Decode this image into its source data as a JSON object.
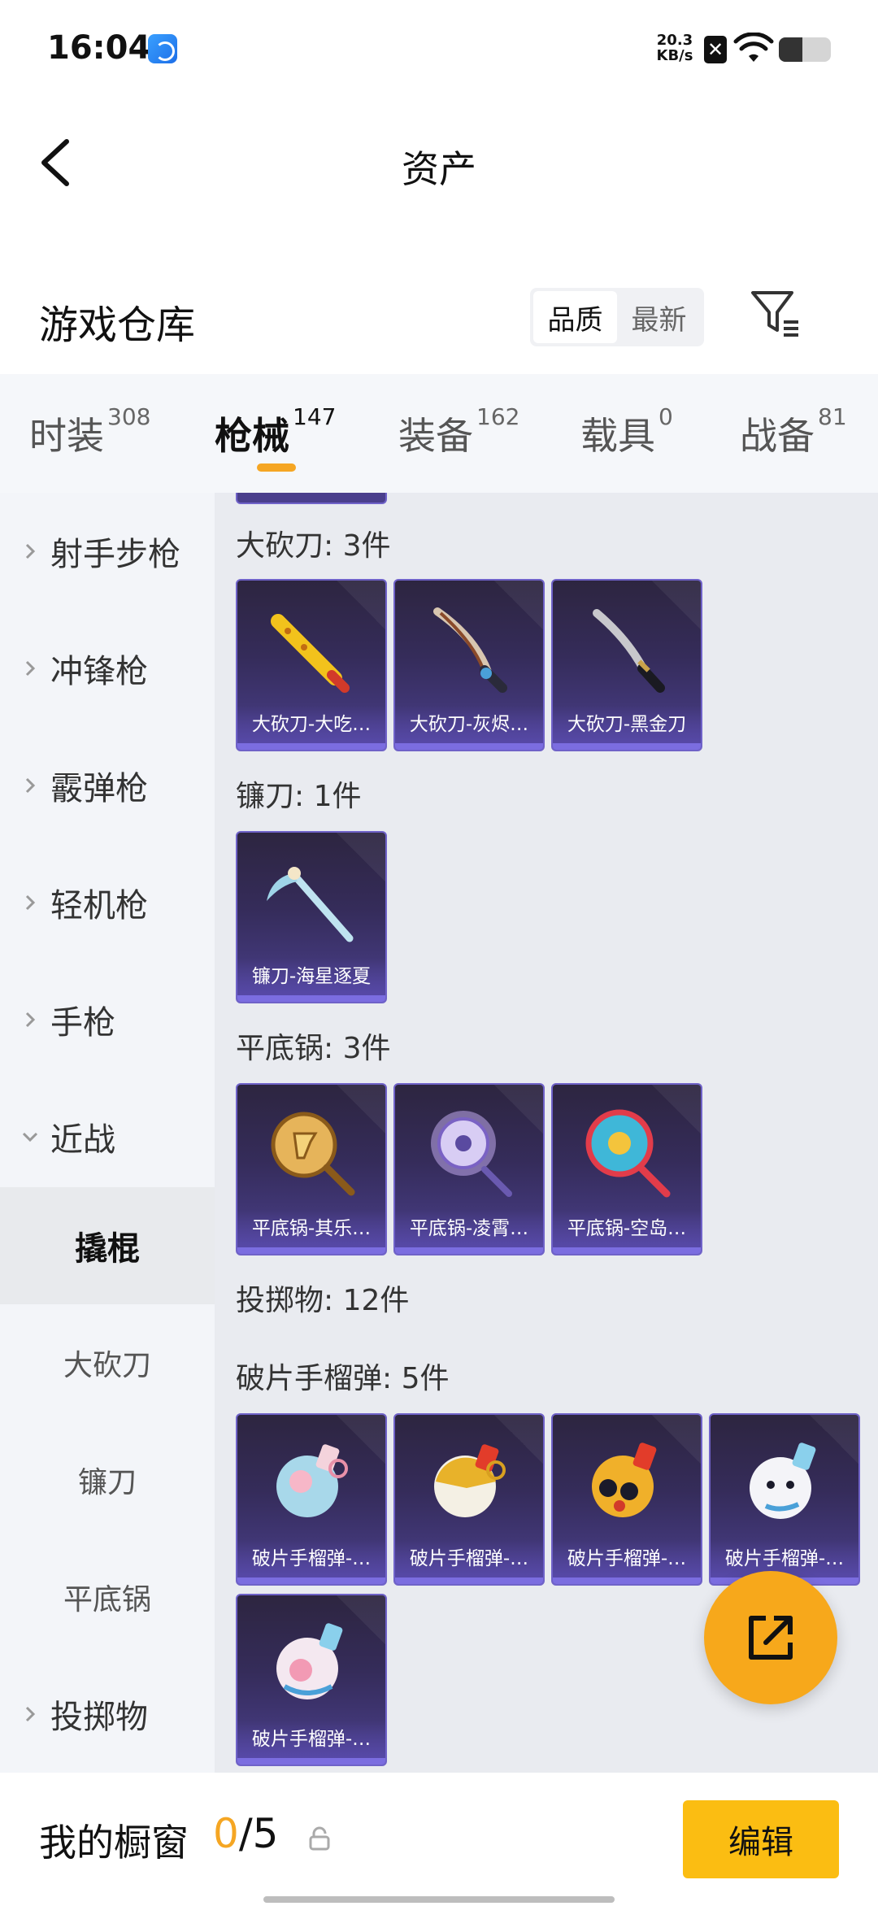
{
  "status_bar": {
    "time": "16:04",
    "net_speed_value": "20.3",
    "net_speed_unit": "KB/s",
    "battery_level": 0.45
  },
  "nav": {
    "title": "资产"
  },
  "header": {
    "title": "游戏仓库",
    "sort_options": [
      "品质",
      "最新"
    ],
    "selected_sort": "品质"
  },
  "tabs": [
    {
      "label": "时装",
      "count": "308"
    },
    {
      "label": "枪械",
      "count": "147",
      "active": true
    },
    {
      "label": "装备",
      "count": "162"
    },
    {
      "label": "载具",
      "count": "0"
    },
    {
      "label": "战备",
      "count": "81"
    }
  ],
  "sidebar": {
    "categories": [
      "射手步枪",
      "冲锋枪",
      "霰弹枪",
      "轻机枪",
      "手枪",
      "近战"
    ],
    "sub_items": [
      "撬棍",
      "大砍刀",
      "镰刀",
      "平底锅"
    ],
    "last_category": "投掷物",
    "active_sub": "撬棍"
  },
  "content": {
    "sections": [
      {
        "title": "大砍刀: 3件",
        "items": [
          "大砍刀-大吃…",
          "大砍刀-灰烬…",
          "大砍刀-黑金刀"
        ]
      },
      {
        "title": "镰刀: 1件",
        "items": [
          "镰刀-海星逐夏"
        ]
      },
      {
        "title": "平底锅: 3件",
        "items": [
          "平底锅-其乐…",
          "平底锅-凌霄…",
          "平底锅-空岛…"
        ]
      },
      {
        "title": "投掷物: 12件",
        "items": []
      },
      {
        "title": "破片手榴弹: 5件",
        "items": [
          "破片手榴弹-…",
          "破片手榴弹-…",
          "破片手榴弹-…",
          "破片手榴弹-…",
          "破片手榴弹-…"
        ]
      }
    ]
  },
  "bottom_bar": {
    "label": "我的橱窗",
    "current": "0",
    "separator": "/",
    "max": "5",
    "edit_label": "编辑"
  },
  "colors": {
    "accent": "#f5a623",
    "edit_button": "#fbbd12",
    "card_border": "#6f62c8"
  }
}
